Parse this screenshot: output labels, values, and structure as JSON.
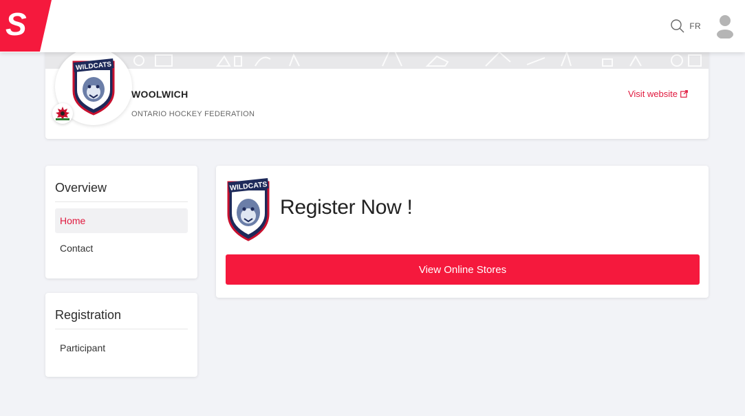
{
  "header": {
    "brand_icon": "spordle-logo",
    "brand_color": "#f5193d",
    "search_icon": "search-icon",
    "language_toggle": "FR",
    "avatar_icon": "user-avatar-icon"
  },
  "organization": {
    "name": "WOOLWICH",
    "federation": "ONTARIO HOCKEY FEDERATION",
    "visit_website_label": "Visit website",
    "logo_icon": "wildcats-crest",
    "logo_text": "WILDCATS",
    "federation_badge_icon": "hockey-canada-badge"
  },
  "sidebar": {
    "overview": {
      "title": "Overview",
      "items": [
        {
          "label": "Home",
          "active": true
        },
        {
          "label": "Contact",
          "active": false
        }
      ]
    },
    "registration": {
      "title": "Registration",
      "items": [
        {
          "label": "Participant",
          "active": false
        }
      ]
    }
  },
  "register": {
    "title": "Register Now !",
    "button_label": "View Online Stores"
  },
  "colors": {
    "accent": "#e0193e",
    "button": "#f5193d",
    "background": "#f2f3f7"
  }
}
